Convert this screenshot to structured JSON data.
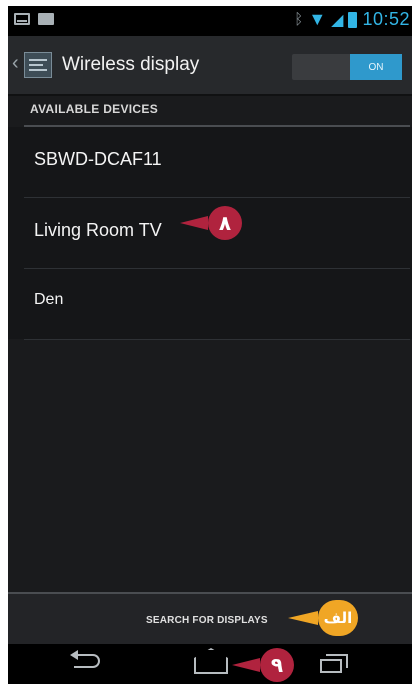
{
  "status_bar": {
    "time": "10:52",
    "icons": [
      "mail-icon",
      "media-icon",
      "bluetooth-icon",
      "wifi-icon",
      "signal-icon",
      "battery-icon"
    ]
  },
  "action_bar": {
    "title": "Wireless display",
    "toggle_label": "ON"
  },
  "list": {
    "header": "AVAILABLE DEVICES",
    "devices": [
      "SBWD-DCAF11",
      "Living Room TV",
      "Den"
    ]
  },
  "search_button": {
    "label": "SEARCH FOR DISPLAYS"
  },
  "callouts": {
    "device": "٨",
    "search": "الف",
    "home": "٩"
  },
  "colors": {
    "accent": "#32b5e5",
    "toggle_on": "#2f99cc",
    "callout_red": "#b0233e",
    "callout_orange": "#f0a625"
  }
}
